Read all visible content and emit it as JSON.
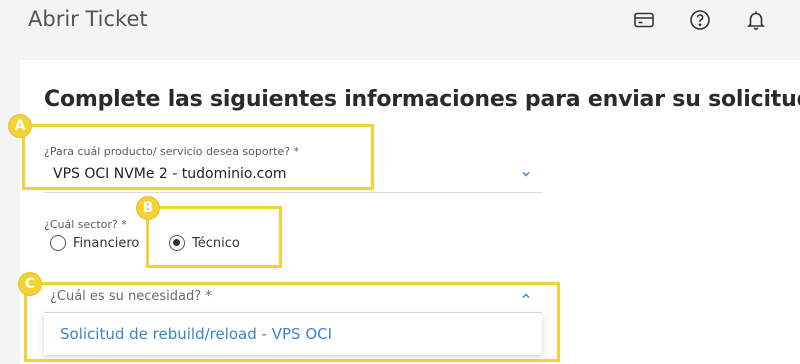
{
  "header": {
    "title": "Abrir Ticket",
    "icons": [
      "card-icon",
      "help-icon",
      "bell-icon"
    ]
  },
  "form": {
    "heading": "Complete las siguientes informaciones para enviar su solicitud",
    "product": {
      "label": "¿Para cuál producto/ servicio desea soporte? *",
      "value": "VPS OCI NVMe 2 - tudominio.com"
    },
    "sector": {
      "label": "¿Cuál sector? *",
      "options": [
        {
          "label": "Financiero",
          "selected": false
        },
        {
          "label": "Técnico",
          "selected": true
        }
      ]
    },
    "need": {
      "label": "¿Cuál es su necesidad? *",
      "options": [
        "Solicitud de rebuild/reload - VPS OCI"
      ]
    }
  },
  "annotations": {
    "badges": [
      "A",
      "B",
      "C"
    ],
    "color": "#f2d235"
  },
  "colors": {
    "accent": "#3a86c8",
    "highlight": "#f2d235",
    "background": "#f4f4f5"
  }
}
